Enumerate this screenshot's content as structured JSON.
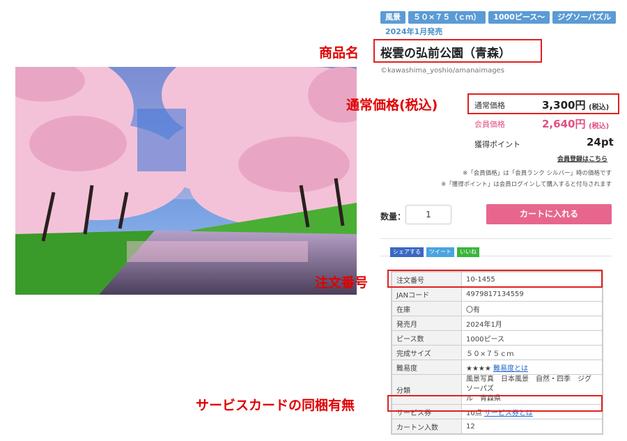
{
  "tags": [
    "風景",
    "５０×７５（ｃｍ）",
    "1000ピース〜",
    "ジグソーパズル"
  ],
  "release": "2024年1月発売",
  "title": "桜雲の弘前公園（青森）",
  "credit": "©kawashima_yoshio/amanaimages",
  "annot": {
    "product_name": "商品名",
    "regular_price": "通常価格(税込)",
    "order_no": "注文番号",
    "service": "サービスカードの同梱有無"
  },
  "price": {
    "regular_label": "通常価格",
    "regular_value": "3,300円",
    "regular_tax": "(税込)",
    "member_label": "会員価格",
    "member_value": "2,640円",
    "member_tax": "(税込)",
    "points_label": "獲得ポイント",
    "points_value": "24pt",
    "register_link": "会員登録はこちら",
    "note1": "※「会員価格」は「会員ランク シルバー」時の価格です",
    "note2": "※「獲得ポイント」は会員ログインして購入すると付与されます"
  },
  "qty": {
    "label": "数量：",
    "value": "1"
  },
  "cart_button": "カートに入れる",
  "share": {
    "facebook": "シェアする",
    "twitter": "ツイート",
    "line": "いいね"
  },
  "specs": {
    "order_no_k": "注文番号",
    "order_no_v": "10-1455",
    "jan_k": "JANコード",
    "jan_v": "4979817134559",
    "stock_k": "在庫",
    "stock_v": "〇有",
    "release_k": "発売月",
    "release_v": "2024年1月",
    "pieces_k": "ピース数",
    "pieces_v": "1000ピース",
    "size_k": "完成サイズ",
    "size_v": "５０×７５ｃｍ",
    "difficulty_k": "難易度",
    "difficulty_stars": "★★★★",
    "difficulty_link": "難易度とは",
    "category_k": "分類",
    "category_v1": "風景写真　日本風景　自然・四季　ジグソーパズ",
    "category_v2": "ル　青森県",
    "service_k": "サービス券",
    "service_v": "10点",
    "service_link": "サービス券とは",
    "carton_k": "カートン入数",
    "carton_v": "12"
  }
}
